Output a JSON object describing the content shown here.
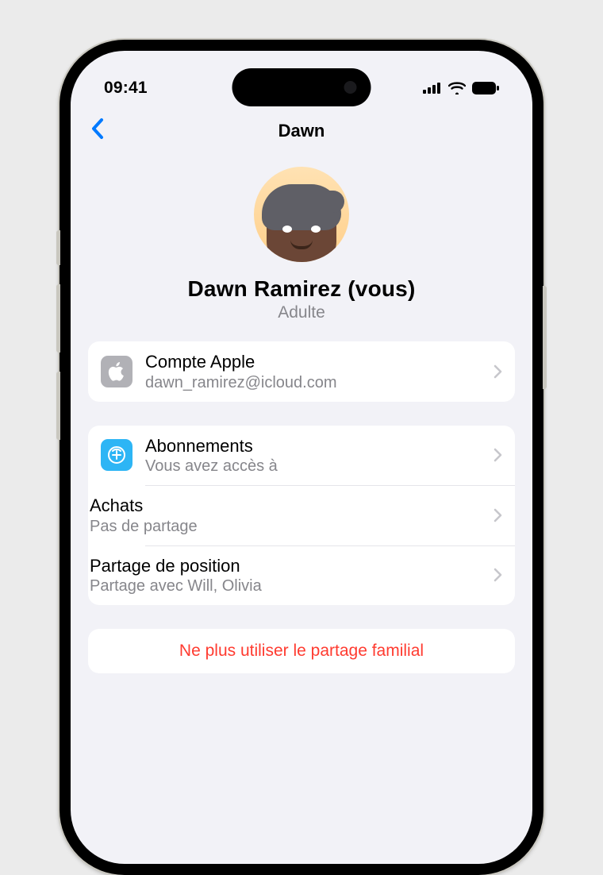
{
  "status": {
    "time": "09:41"
  },
  "nav": {
    "title": "Dawn"
  },
  "profile": {
    "name": "Dawn Ramirez (vous)",
    "role": "Adulte"
  },
  "account": {
    "title": "Compte Apple",
    "email": "dawn_ramirez@icloud.com"
  },
  "settings": {
    "subscriptions": {
      "title": "Abonnements",
      "subtitle": "Vous avez accès à"
    },
    "purchases": {
      "title": "Achats",
      "subtitle": "Pas de partage"
    },
    "location": {
      "title": "Partage de position",
      "subtitle": "Partage avec Will, Olivia"
    }
  },
  "danger": {
    "label": "Ne plus utiliser le partage familial"
  }
}
